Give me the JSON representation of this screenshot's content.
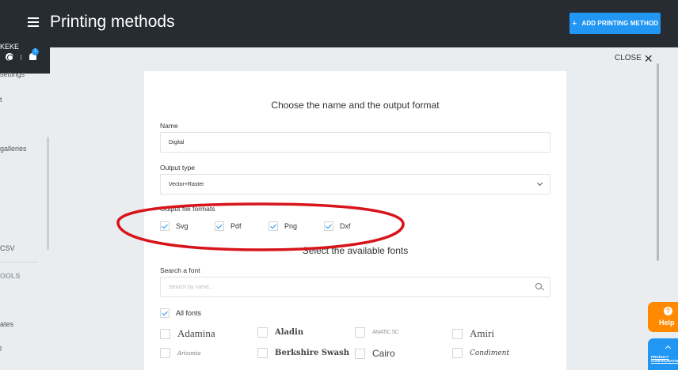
{
  "header": {
    "title": "Printing methods",
    "add_button_label": "ADD PRINTING METHOD",
    "add_button_icon": "+"
  },
  "user": {
    "name": "KEKE",
    "notification_count": "1"
  },
  "sidebar": {
    "items": [
      {
        "label": "settings"
      },
      {
        "label": "t"
      },
      {
        "label": "galleries"
      },
      {
        "label": "CSV"
      },
      {
        "label": "ates"
      },
      {
        "label": "l"
      }
    ],
    "section_label": "OOLS"
  },
  "close": {
    "label": "CLOSE"
  },
  "form": {
    "heading": "Choose the name and the output format",
    "name_label": "Name",
    "name_value": "Digital",
    "output_type_label": "Output type",
    "output_type_value": "Vector+Raster",
    "output_formats_label": "Output file formats",
    "formats": [
      {
        "label": "Svg",
        "checked": true
      },
      {
        "label": "Pdf",
        "checked": true
      },
      {
        "label": "Png",
        "checked": true
      },
      {
        "label": "Dxf",
        "checked": true
      }
    ],
    "fonts_heading": "Select the available fonts",
    "search_font_label": "Search a font",
    "search_placeholder": "Search by name...",
    "all_fonts_label": "All fonts",
    "fonts": [
      {
        "label": "Adamina",
        "checked": false
      },
      {
        "label": "Aladin",
        "checked": false
      },
      {
        "label": "AMATIC SC",
        "checked": false
      },
      {
        "label": "Amiri",
        "checked": false
      },
      {
        "label": "Arizonia",
        "checked": false
      },
      {
        "label": "Berkshire Swash",
        "checked": false
      },
      {
        "label": "Cairo",
        "checked": false
      },
      {
        "label": "Condiment",
        "checked": false
      }
    ]
  },
  "floating": {
    "help_label": "Help",
    "help_icon": "?",
    "product_configurator_label": "PRODUCT CONFIGURATOR"
  },
  "colors": {
    "topbar": "#262c31",
    "accent": "#2196f3",
    "help": "#ff8a00",
    "annotation": "#d8141b",
    "background": "#e9edf0"
  }
}
